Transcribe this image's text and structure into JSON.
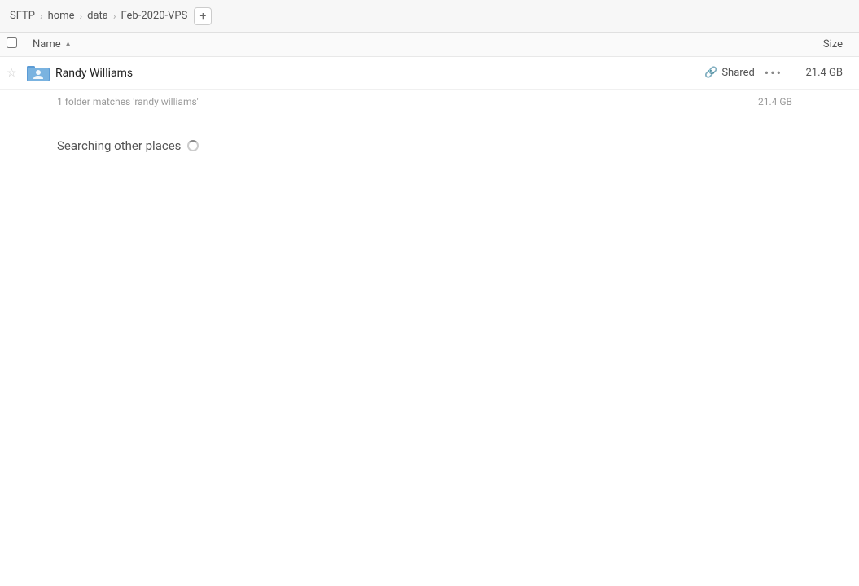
{
  "breadcrumb": {
    "items": [
      {
        "label": "SFTP",
        "id": "sftp"
      },
      {
        "label": "home",
        "id": "home"
      },
      {
        "label": "data",
        "id": "data"
      },
      {
        "label": "Feb-2020-VPS",
        "id": "feb-2020-vps"
      }
    ],
    "add_button_label": "+"
  },
  "column_header": {
    "name_label": "Name",
    "sort_indicator": "▲",
    "size_label": "Size"
  },
  "file_row": {
    "name": "Randy Williams",
    "shared_label": "Shared",
    "more_label": "•••",
    "size": "21.4 GB"
  },
  "search_info": {
    "text": "1 folder matches 'randy williams'",
    "size": "21.4 GB"
  },
  "searching_section": {
    "label": "Searching other places"
  }
}
